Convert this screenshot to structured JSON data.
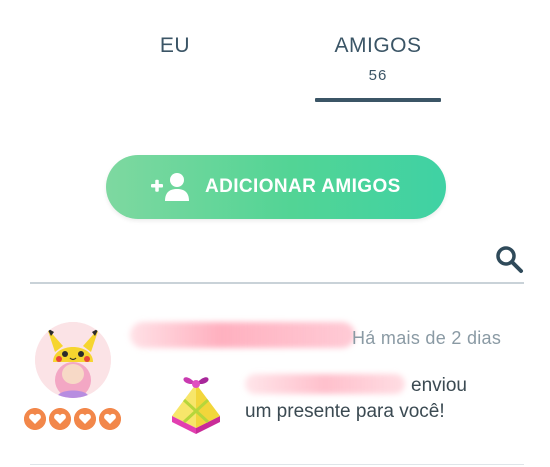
{
  "tabs": {
    "me": {
      "label": "EU"
    },
    "friends": {
      "label": "AMIGOS",
      "count": "56",
      "active": true
    }
  },
  "add_friends": {
    "label": "ADICIONAR AMIGOS",
    "icon": "add-person-icon"
  },
  "search": {
    "icon": "search-icon"
  },
  "friends_list": [
    {
      "last_interaction": "Há mais de 2 dias",
      "message_verb": "enviou",
      "message_line2": "um presente para você!",
      "friendship_hearts": 4,
      "avatar_icon": "pikachu-hat-avatar-icon",
      "gift_icon": "gift-icon"
    }
  ],
  "colors": {
    "tab_text": "#3b5566",
    "button_gradient_start": "#7ed8a0",
    "button_gradient_end": "#3fd2a4",
    "heart": "#f2874a",
    "secondary_text": "#8a9aa4"
  }
}
